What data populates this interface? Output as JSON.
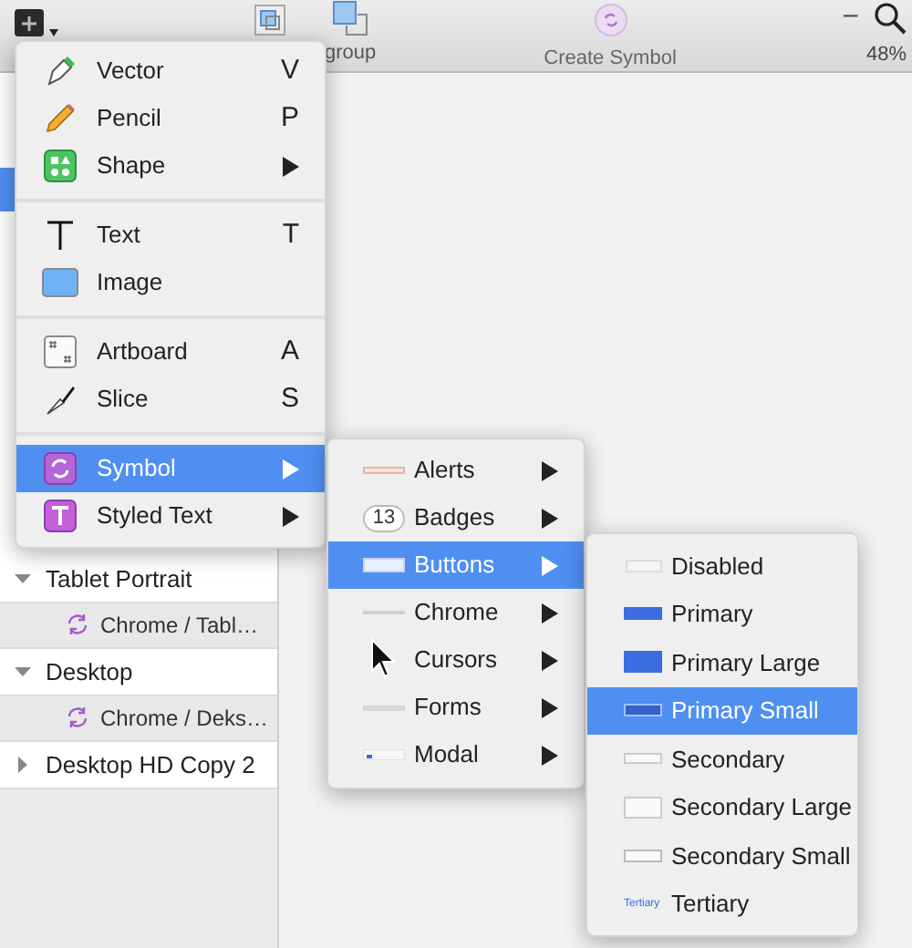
{
  "toolbar": {
    "ungroup_label": "group",
    "create_symbol_label": "Create Symbol",
    "zoom_minus": "−",
    "zoom_level": "48%"
  },
  "sidebar": {
    "rows": [
      {
        "kind": "artboard",
        "label": "Tablet Portrait",
        "expanded": true
      },
      {
        "kind": "symbol",
        "label": "Chrome / Tabl…"
      },
      {
        "kind": "artboard",
        "label": "Desktop",
        "expanded": true
      },
      {
        "kind": "symbol",
        "label": "Chrome / Deks…"
      },
      {
        "kind": "artboard",
        "label": "Desktop HD Copy 2",
        "expanded": false
      }
    ]
  },
  "insert_menu": {
    "items": [
      {
        "kind": "item",
        "label": "Vector",
        "shortcut": "V",
        "selected": false
      },
      {
        "kind": "item",
        "label": "Pencil",
        "shortcut": "P",
        "selected": false
      },
      {
        "kind": "item",
        "label": "Shape",
        "submenu": true,
        "selected": false
      },
      {
        "kind": "separator"
      },
      {
        "kind": "item",
        "label": "Text",
        "shortcut": "T",
        "selected": false
      },
      {
        "kind": "item",
        "label": "Image",
        "selected": false
      },
      {
        "kind": "separator"
      },
      {
        "kind": "item",
        "label": "Artboard",
        "shortcut": "A",
        "selected": false
      },
      {
        "kind": "item",
        "label": "Slice",
        "shortcut": "S",
        "selected": false
      },
      {
        "kind": "separator"
      },
      {
        "kind": "item",
        "label": "Symbol",
        "submenu": true,
        "selected": true
      },
      {
        "kind": "item",
        "label": "Styled Text",
        "submenu": true,
        "selected": false
      }
    ]
  },
  "symbol_menu": {
    "items": [
      {
        "kind": "alert",
        "label": "Alerts",
        "selected": false
      },
      {
        "kind": "badge",
        "label": "Badges",
        "badge": "13",
        "selected": false
      },
      {
        "kind": "button",
        "label": "Buttons",
        "selected": true
      },
      {
        "kind": "line",
        "label": "Chrome",
        "selected": false
      },
      {
        "kind": "none",
        "label": "Cursors",
        "selected": false
      },
      {
        "kind": "form",
        "label": "Forms",
        "selected": false
      },
      {
        "kind": "modal",
        "label": "Modal",
        "selected": false
      }
    ]
  },
  "buttons_menu": {
    "items": [
      {
        "kind": "disabled",
        "label": "Disabled",
        "selected": false
      },
      {
        "kind": "primary",
        "label": "Primary",
        "selected": false
      },
      {
        "kind": "primary-large",
        "label": "Primary Large",
        "selected": false
      },
      {
        "kind": "primary-small",
        "label": "Primary Small",
        "selected": true
      },
      {
        "kind": "secondary",
        "label": "Secondary",
        "selected": false
      },
      {
        "kind": "secondary-large",
        "label": "Secondary Large",
        "selected": false
      },
      {
        "kind": "secondary-small",
        "label": "Secondary Small",
        "selected": false
      },
      {
        "kind": "tertiary",
        "label": "Tertiary",
        "preview": "Tertiary",
        "selected": false
      }
    ]
  }
}
